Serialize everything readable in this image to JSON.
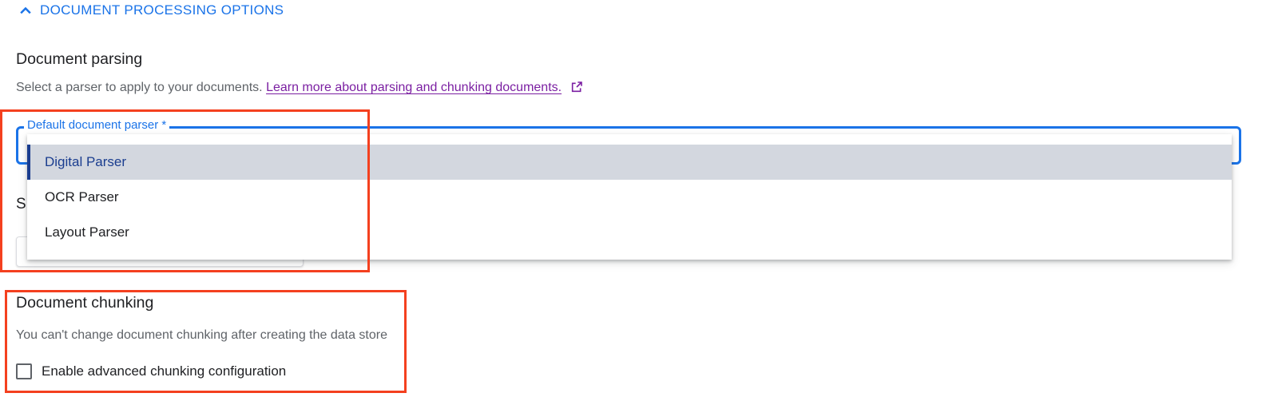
{
  "section_toggle": {
    "label": "DOCUMENT PROCESSING OPTIONS",
    "icon": "chevron-up-icon"
  },
  "parsing": {
    "heading": "Document parsing",
    "description": "Select a parser to apply to your documents.",
    "learn_more": "Learn more about parsing and chunking documents.",
    "external_icon": "open-in-new-icon"
  },
  "parser_select": {
    "label": "Default document parser *",
    "selected": "Digital Parser",
    "options": [
      "Digital Parser",
      "OCR Parser",
      "Layout Parser"
    ]
  },
  "obscured": {
    "partial_text": "S"
  },
  "chunking": {
    "heading": "Document chunking",
    "description": "You can't change document chunking after creating the data store",
    "checkbox_label": "Enable advanced chunking configuration",
    "checkbox_checked": false
  },
  "colors": {
    "accent": "#1a73e8",
    "link": "#7b1fa2",
    "selected_bg": "#d3d7df",
    "annotation": "#f4401f"
  }
}
